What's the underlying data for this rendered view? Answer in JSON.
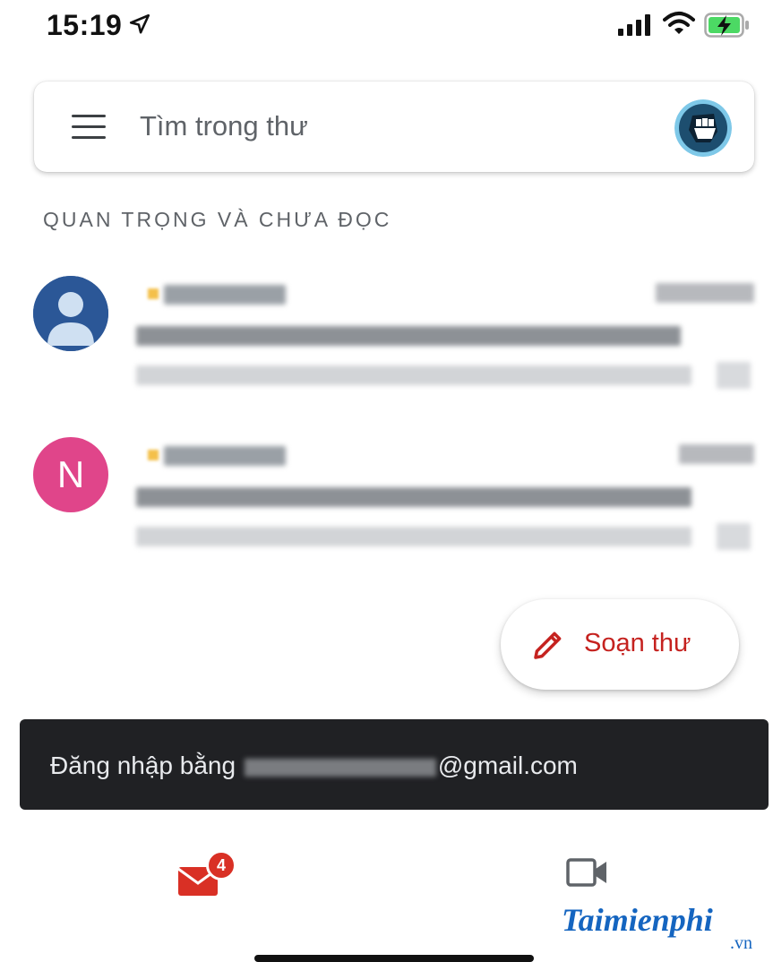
{
  "status_bar": {
    "time": "15:19"
  },
  "search": {
    "placeholder": "Tìm trong thư"
  },
  "section": {
    "label": "QUAN TRỌNG VÀ CHƯA ĐỌC"
  },
  "emails": [
    {
      "avatar": "person-icon"
    },
    {
      "avatar_letter": "N"
    }
  ],
  "compose": {
    "label": "Soạn thư"
  },
  "snackbar": {
    "prefix": "Đăng nhập bằng",
    "suffix": "@gmail.com"
  },
  "bottom_nav": {
    "mail_badge": "4"
  },
  "watermark": {
    "main": "Taimienphi",
    "tld": ".vn"
  },
  "colors": {
    "accent_red": "#d93025",
    "compose_text": "#c5221f",
    "snackbar_bg": "#202124",
    "avatar_blue": "#2b5797",
    "avatar_pink": "#e0458a"
  }
}
